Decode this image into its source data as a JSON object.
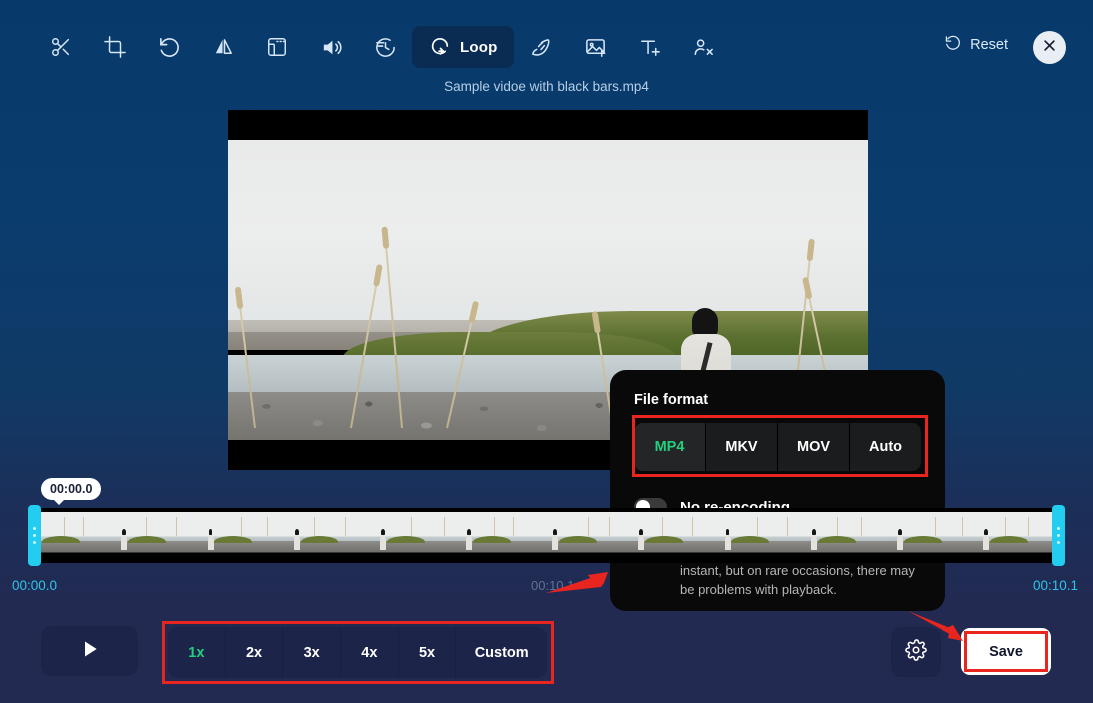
{
  "app": {
    "filename": "Sample vidoe with black bars.mp4"
  },
  "toolbar": {
    "items": [
      {
        "icon": "cut-icon",
        "label": "",
        "active": false
      },
      {
        "icon": "crop-icon",
        "label": "",
        "active": false
      },
      {
        "icon": "rotate-left-icon",
        "label": "",
        "active": false
      },
      {
        "icon": "flip-horizontal-icon",
        "label": "",
        "active": false
      },
      {
        "icon": "resize-icon",
        "label": "",
        "active": false
      },
      {
        "icon": "volume-icon",
        "label": "",
        "active": false
      },
      {
        "icon": "speed-icon",
        "label": "",
        "active": false
      },
      {
        "icon": "loop-icon",
        "label": "Loop",
        "active": true
      },
      {
        "icon": "stabilize-icon",
        "label": "",
        "active": false
      },
      {
        "icon": "add-image-icon",
        "label": "",
        "active": false
      },
      {
        "icon": "add-text-icon",
        "label": "",
        "active": false
      },
      {
        "icon": "remove-watermark-icon",
        "label": "",
        "active": false
      }
    ],
    "reset_label": "Reset",
    "reset_icon": "undo-icon",
    "close_icon": "close-icon"
  },
  "panel": {
    "title": "File format",
    "formats": [
      {
        "label": "MP4",
        "selected": true
      },
      {
        "label": "MKV",
        "selected": false
      },
      {
        "label": "MOV",
        "selected": false
      },
      {
        "label": "Auto",
        "selected": false
      }
    ],
    "toggle": {
      "label": "No re-encoding",
      "enabled": false
    },
    "description": "This option is only available when trimming or rotating. If enabled, the save will be instant, but on rare occasions, there may be problems with playback."
  },
  "timeline": {
    "tooltip_time": "00:00.0",
    "start_time": "00:00.0",
    "total_time": "00:10.1",
    "end_time": "00:10.1"
  },
  "bottom": {
    "play_icon": "play-icon",
    "speeds": [
      {
        "label": "1x",
        "selected": true
      },
      {
        "label": "2x",
        "selected": false
      },
      {
        "label": "3x",
        "selected": false
      },
      {
        "label": "4x",
        "selected": false
      },
      {
        "label": "5x",
        "selected": false
      },
      {
        "label": "Custom",
        "selected": false
      }
    ],
    "settings_icon": "gear-icon",
    "save_label": "Save"
  },
  "colors": {
    "background_top": "#0a3c6e",
    "background_bottom": "#232a51",
    "accent_green": "#22d07f",
    "accent_cyan": "#22cdef",
    "annotation_red": "#e8251f",
    "panel_background": "#090909"
  }
}
